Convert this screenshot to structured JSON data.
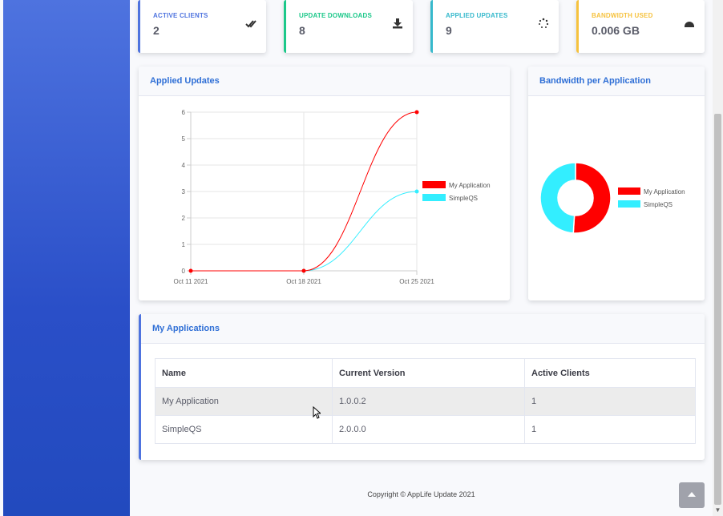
{
  "colors": {
    "primary": "#4e73df",
    "success": "#1cc88a",
    "info": "#36b9cc",
    "warning": "#f6c23e",
    "series_my_application": "#ff0000",
    "series_simpleqs": "#33eeff"
  },
  "stats": [
    {
      "label": "ACTIVE CLIENTS",
      "value": "2",
      "icon": "double-check-icon",
      "color": "#4e73df"
    },
    {
      "label": "UPDATE DOWNLOADS",
      "value": "8",
      "icon": "download-icon",
      "color": "#1cc88a"
    },
    {
      "label": "APPLIED UPDATES",
      "value": "9",
      "icon": "spinner-icon",
      "color": "#36b9cc"
    },
    {
      "label": "BANDWIDTH USED",
      "value": "0.006 GB",
      "icon": "gauge-icon",
      "color": "#f6c23e"
    }
  ],
  "applied_updates_card": {
    "title": "Applied Updates"
  },
  "bandwidth_card": {
    "title": "Bandwidth per Application"
  },
  "chart_data": [
    {
      "type": "line",
      "title": "Applied Updates",
      "x": [
        "Oct 11 2021",
        "Oct 18 2021",
        "Oct 25 2021"
      ],
      "y_ticks": [
        "0",
        "1",
        "2",
        "3",
        "4",
        "5",
        "6"
      ],
      "ylim": [
        0,
        6
      ],
      "grid": true,
      "legend_position": "right",
      "series": [
        {
          "name": "My Application",
          "values": [
            0,
            0,
            6
          ],
          "color": "#ff0000"
        },
        {
          "name": "SimpleQS",
          "values": [
            0,
            0,
            3
          ],
          "color": "#33eeff"
        }
      ]
    },
    {
      "type": "pie",
      "title": "Bandwidth per Application",
      "donut": true,
      "legend_position": "right",
      "labels": [
        "My Application",
        "SimpleQS"
      ],
      "values": [
        51,
        49
      ],
      "colors": [
        "#ff0000",
        "#33eeff"
      ]
    }
  ],
  "my_applications": {
    "title": "My Applications",
    "columns": [
      "Name",
      "Current Version",
      "Active Clients"
    ],
    "rows": [
      [
        "My Application",
        "1.0.0.2",
        "1"
      ],
      [
        "SimpleQS",
        "2.0.0.0",
        "1"
      ]
    ]
  },
  "footer": {
    "copyright": "Copyright © AppLife Update 2021"
  }
}
